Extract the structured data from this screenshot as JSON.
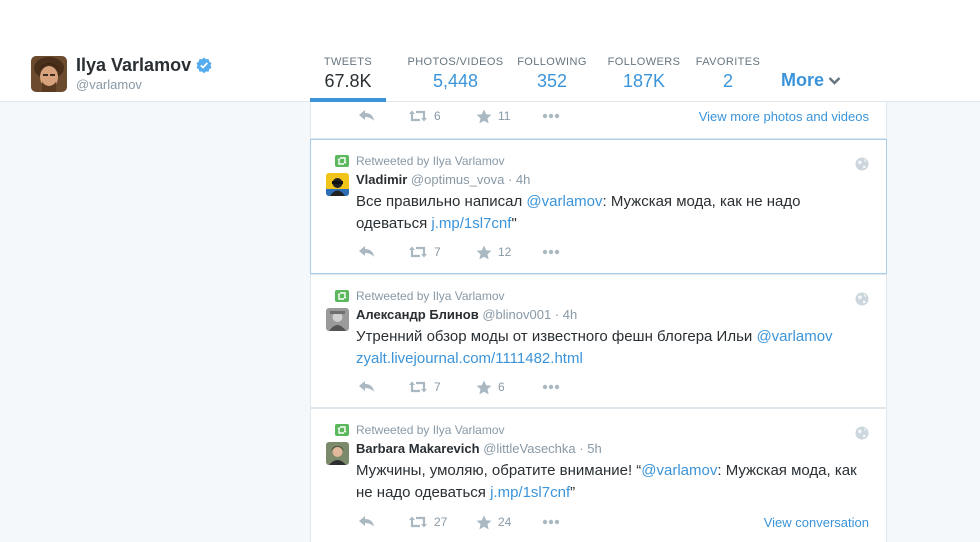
{
  "profile": {
    "name": "Ilya Varlamov",
    "handle": "@varlamov"
  },
  "nav": {
    "items": [
      {
        "label": "TWEETS",
        "value": "67.8K"
      },
      {
        "label": "PHOTOS/VIDEOS",
        "value": "5,448"
      },
      {
        "label": "FOLLOWING",
        "value": "352"
      },
      {
        "label": "FOLLOWERS",
        "value": "187K"
      },
      {
        "label": "FAVORITES",
        "value": "2"
      }
    ],
    "more": "More"
  },
  "top_tweet": {
    "retweets": "6",
    "favorites": "11",
    "link": "View more photos and videos"
  },
  "tweets": [
    {
      "retweeted_by": "Retweeted by Ilya Varlamov",
      "name": "Vladimir",
      "handle": "@optimus_vova",
      "dot": "·",
      "time": "4h",
      "text_before": "Все правильно написал ",
      "mention": "@varlamov",
      "text_middle": ": Мужская мода, как не надо одеваться ",
      "url": "j.mp/1sl7cnf",
      "text_after": "\"",
      "retweets": "7",
      "favorites": "12"
    },
    {
      "retweeted_by": "Retweeted by Ilya Varlamov",
      "name": "Александр Блинов",
      "handle": "@blinov001",
      "dot": "·",
      "time": "4h",
      "text_before": "Утренний обзор моды от известного фешн блогера Ильи ",
      "mention": "@varlamov",
      "text_middle": " ",
      "url": "zyalt.livejournal.com/1111482.html",
      "text_after": "",
      "retweets": "7",
      "favorites": "6"
    },
    {
      "retweeted_by": "Retweeted by Ilya Varlamov",
      "name": "Barbara Makarevich",
      "handle": "@littleVasechka",
      "dot": "·",
      "time": "5h",
      "text_before": "Мужчины, умоляю, обратите внимание! “",
      "mention": "@varlamov",
      "text_middle": ": Мужская мода, как не надо одеваться ",
      "url": "j.mp/1sl7cnf",
      "text_after": "”",
      "retweets": "27",
      "favorites": "24",
      "link": "View conversation"
    }
  ],
  "colors": {
    "accent": "#3b94d9",
    "retweet_green": "#5cb85c",
    "muted": "#8899a6",
    "text": "#292f33",
    "border": "#e1e8ed",
    "background": "#f5f8fa"
  }
}
